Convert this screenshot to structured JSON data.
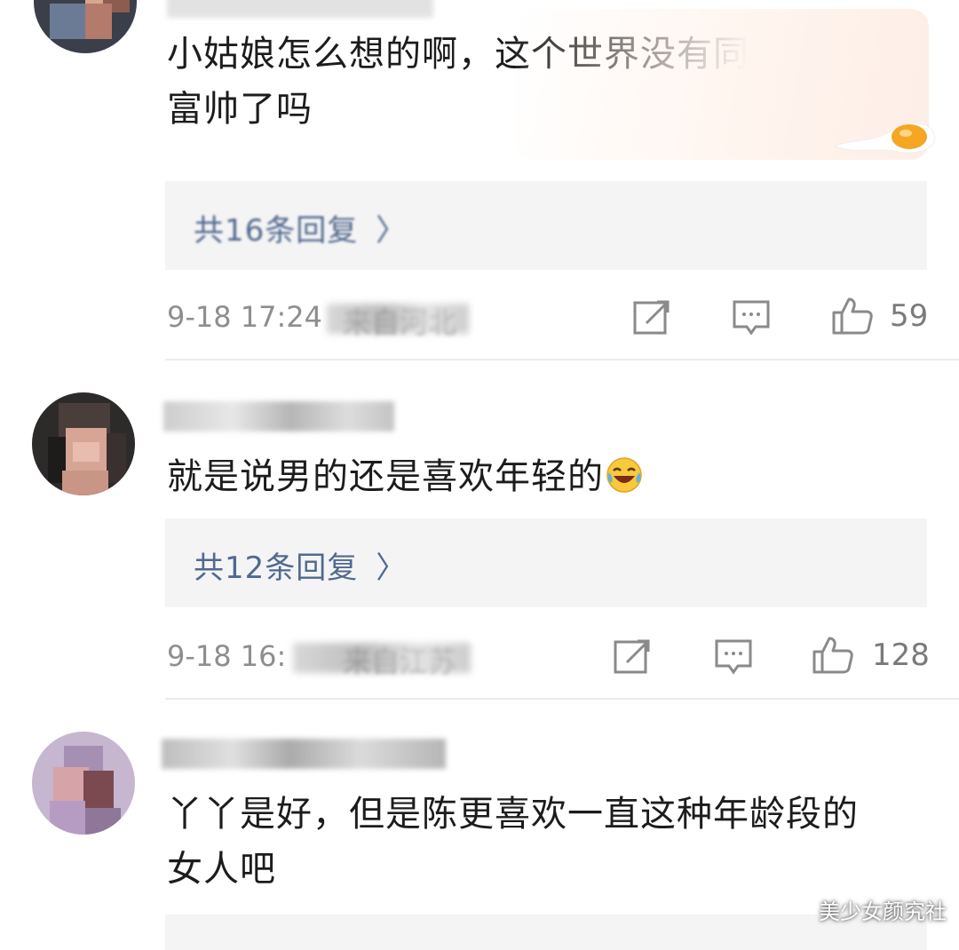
{
  "comments": [
    {
      "text_line1": "小姑娘怎么想的啊，这个世界没有同龄高",
      "text_line2": "富帅了吗",
      "reply_label": "共16条回复",
      "reply_chevron": "〉",
      "date": "9-18 17:24",
      "location": "来自河北",
      "likes": "59"
    },
    {
      "text_line1": "就是说男的还是喜欢年轻的",
      "emoji": "laugh-cry-emoji",
      "reply_label": "共12条回复",
      "reply_chevron": "〉",
      "date": "9-18 16:",
      "location": "来自江苏",
      "likes": "128"
    },
    {
      "text_line1": "丫丫是好，但是陈更喜欢一直这种年龄段的",
      "text_line2": "女人吧"
    }
  ],
  "icons": {
    "share": "share-icon",
    "comment": "comment-icon",
    "like": "thumbs-up-icon"
  },
  "colors": {
    "reply_link": "#50698f",
    "meta": "#8e8e8e",
    "reply_bg": "#f4f4f4"
  },
  "watermark": "美少女颜究社"
}
